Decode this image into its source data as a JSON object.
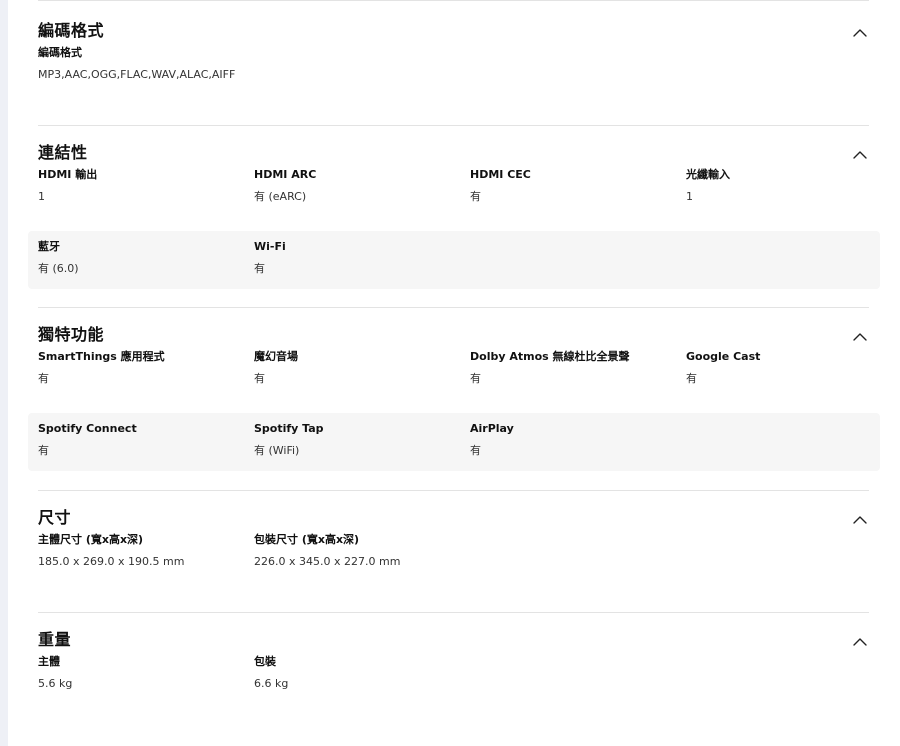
{
  "sections": [
    {
      "title": "編碼格式",
      "rows": [
        [
          {
            "label": "編碼格式",
            "value": "MP3,AAC,OGG,FLAC,WAV,ALAC,AIFF"
          }
        ]
      ]
    },
    {
      "title": "連結性",
      "rows": [
        [
          {
            "label": "HDMI 輸出",
            "value": "1"
          },
          {
            "label": "HDMI ARC",
            "value": "有 (eARC)"
          },
          {
            "label": "HDMI CEC",
            "value": "有"
          },
          {
            "label": "光纖輸入",
            "value": "1"
          }
        ],
        [
          {
            "label": "藍牙",
            "value": "有 (6.0)"
          },
          {
            "label": "Wi-Fi",
            "value": "有"
          }
        ]
      ]
    },
    {
      "title": "獨特功能",
      "rows": [
        [
          {
            "label": "SmartThings 應用程式",
            "value": "有"
          },
          {
            "label": "魔幻音場",
            "value": "有"
          },
          {
            "label": "Dolby Atmos 無線杜比全景聲",
            "value": "有"
          },
          {
            "label": "Google Cast",
            "value": "有"
          }
        ],
        [
          {
            "label": "Spotify Connect",
            "value": "有"
          },
          {
            "label": "Spotify Tap",
            "value": "有 (WiFi)"
          },
          {
            "label": "AirPlay",
            "value": "有"
          }
        ]
      ]
    },
    {
      "title": "尺寸",
      "rows": [
        [
          {
            "label": "主體尺寸 (寬x高x深)",
            "value": "185.0 x 269.0 x 190.5 mm"
          },
          {
            "label": "包裝尺寸 (寬x高x深)",
            "value": "226.0 x 345.0 x 227.0 mm"
          }
        ]
      ]
    },
    {
      "title": "重量",
      "rows": [
        [
          {
            "label": "主體",
            "value": "5.6 kg"
          },
          {
            "label": "包裝",
            "value": "6.6 kg"
          }
        ]
      ]
    }
  ],
  "icons": {
    "collapse": "chevron-up-icon"
  },
  "colors": {
    "divider": "#e3e3e3",
    "shaded_row": "#f6f6f6",
    "text": "#111111"
  }
}
